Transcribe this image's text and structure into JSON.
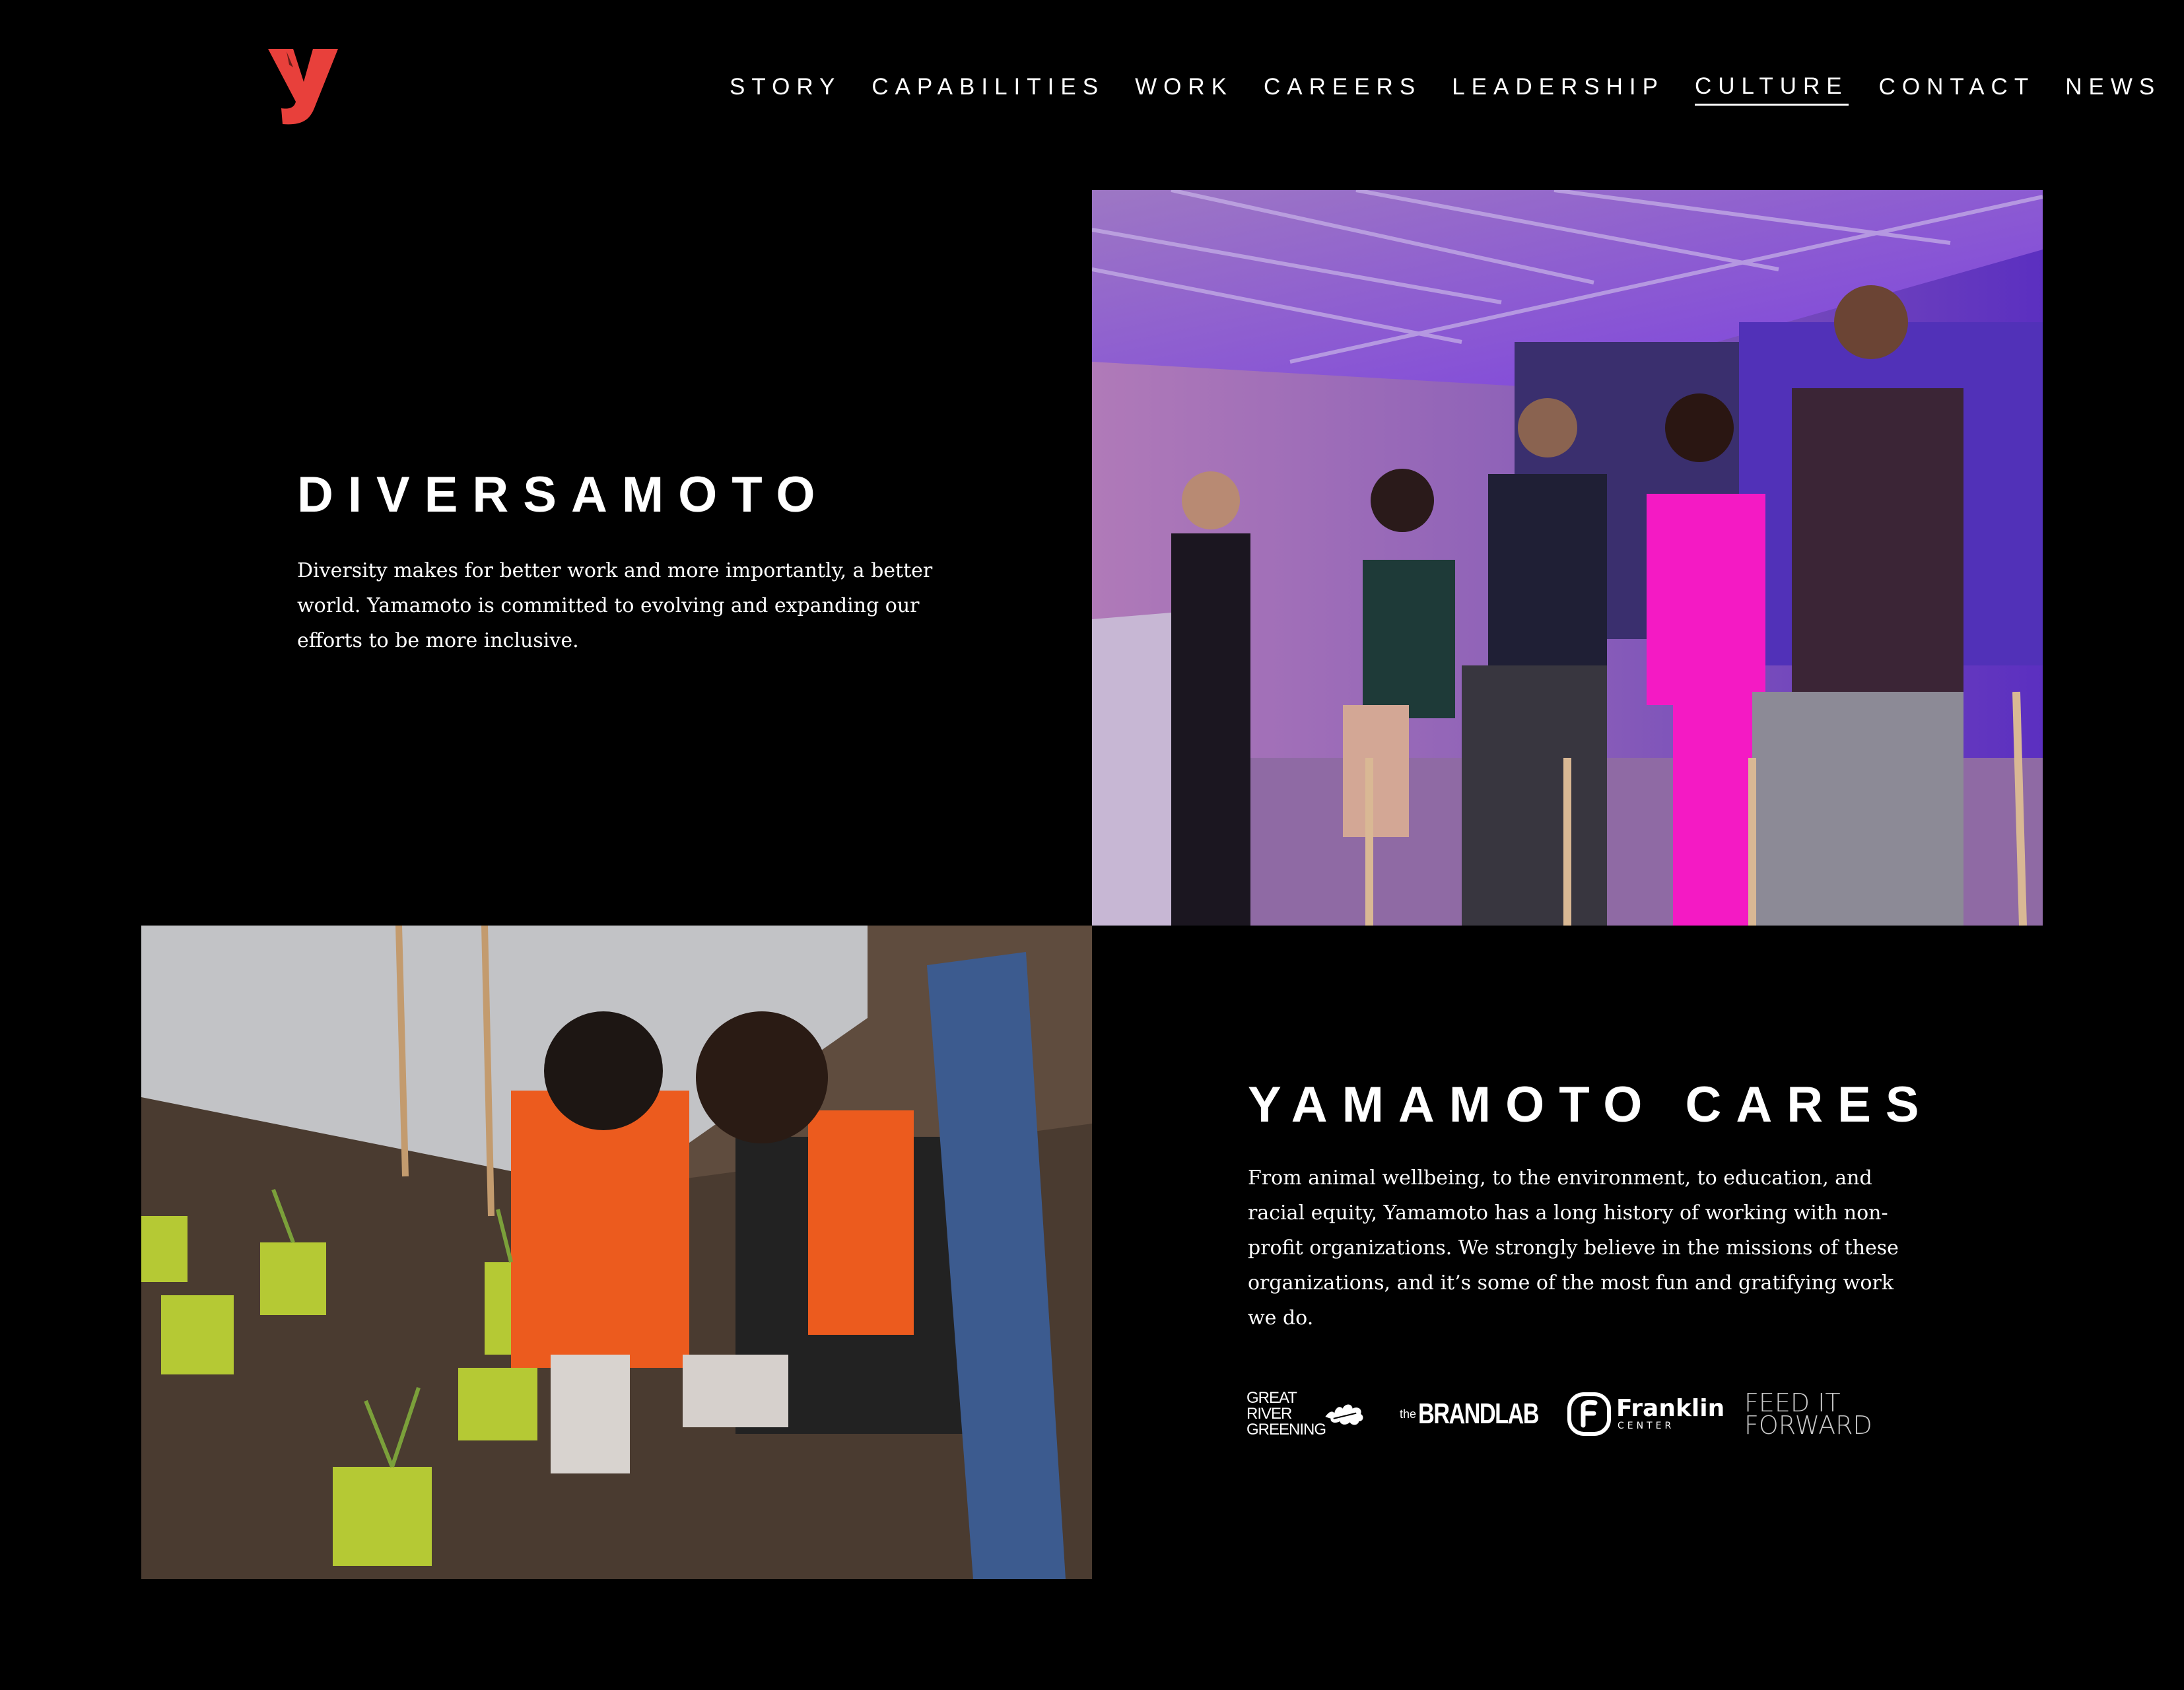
{
  "brand": {
    "logo_letter": "y",
    "logo_color": "#e8403b"
  },
  "nav": {
    "items": [
      {
        "label": "STORY"
      },
      {
        "label": "CAPABILITIES"
      },
      {
        "label": "WORK"
      },
      {
        "label": "CAREERS"
      },
      {
        "label": "LEADERSHIP"
      },
      {
        "label": "CULTURE",
        "active": true
      },
      {
        "label": "CONTACT"
      },
      {
        "label": "NEWS"
      }
    ]
  },
  "diversity": {
    "title": "DIVERSAMOTO",
    "body_lines": [
      "Diversity makes for better work and more importantly, a better",
      "world. Yamamoto is committed to evolving and expanding  our",
      "efforts to be more inclusive."
    ],
    "image": "panel-discussion-stage-photo"
  },
  "cares": {
    "title": "YAMAMOTO CARES",
    "body_lines": [
      "From animal wellbeing, to the environment, to education, and",
      "racial equity, Yamamoto has a long history of working with non-",
      "profit organizations. We strongly believe in the missions of these",
      "organizations, and it’s some of the most fun and gratifying work",
      "we do."
    ],
    "image": "volunteers-planting-photo",
    "partners": {
      "grg": [
        "GREAT",
        "RIVER",
        "GREENING"
      ],
      "brandlab_the": "the",
      "brandlab_name": "BRANDLAB",
      "franklin_name": "Franklin",
      "franklin_sub": "CENTER",
      "feed": [
        "FEED IT",
        "FORWARD"
      ]
    }
  }
}
